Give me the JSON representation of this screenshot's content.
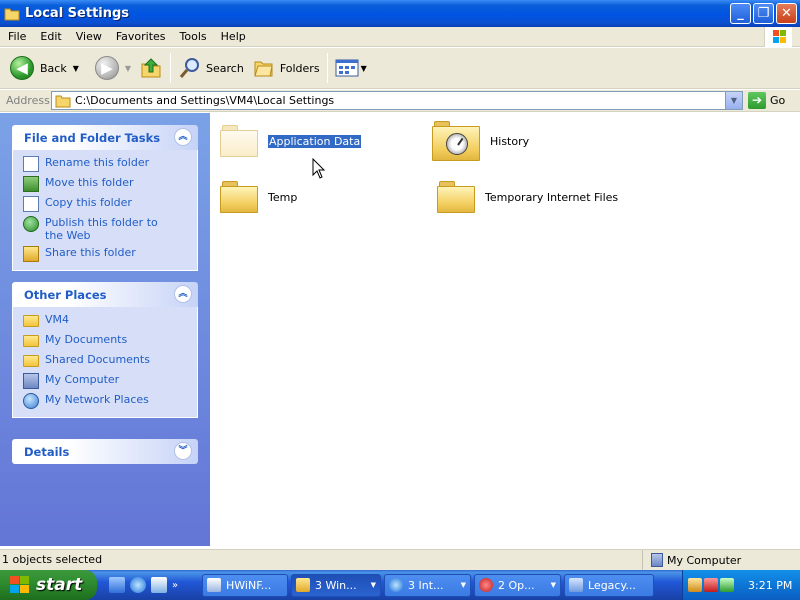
{
  "window": {
    "title": "Local Settings",
    "buttons": {
      "minimize": "_",
      "maximize": "❐",
      "close": "✕"
    }
  },
  "menu": {
    "items": [
      "File",
      "Edit",
      "View",
      "Favorites",
      "Tools",
      "Help"
    ]
  },
  "toolbar": {
    "back_label": "Back",
    "search_label": "Search",
    "folders_label": "Folders"
  },
  "address": {
    "label": "Address",
    "value": "C:\\Documents and Settings\\VM4\\Local Settings",
    "go_label": "Go"
  },
  "task_panes": {
    "file_tasks": {
      "title": "File and Folder Tasks",
      "items": [
        {
          "label": "Rename this folder",
          "icon": "rename-icon"
        },
        {
          "label": "Move this folder",
          "icon": "move-icon"
        },
        {
          "label": "Copy this folder",
          "icon": "copy-icon"
        },
        {
          "label": "Publish this folder to the Web",
          "icon": "publish-web-icon"
        },
        {
          "label": "Share this folder",
          "icon": "share-icon"
        }
      ]
    },
    "other_places": {
      "title": "Other Places",
      "items": [
        {
          "label": "VM4",
          "icon": "folder-icon"
        },
        {
          "label": "My Documents",
          "icon": "my-documents-icon"
        },
        {
          "label": "Shared Documents",
          "icon": "shared-documents-icon"
        },
        {
          "label": "My Computer",
          "icon": "my-computer-icon"
        },
        {
          "label": "My Network Places",
          "icon": "network-places-icon"
        }
      ]
    },
    "details": {
      "title": "Details"
    }
  },
  "files": [
    {
      "name": "Application Data",
      "selected": true,
      "icon": "folder-icon"
    },
    {
      "name": "History",
      "selected": false,
      "icon": "history-folder-icon"
    },
    {
      "name": "Temp",
      "selected": false,
      "icon": "folder-icon"
    },
    {
      "name": "Temporary Internet Files",
      "selected": false,
      "icon": "folder-icon"
    }
  ],
  "status": {
    "left": "1 objects selected",
    "right": "My Computer"
  },
  "taskbar": {
    "start_label": "start",
    "quick_launch_more": "»",
    "buttons": [
      {
        "label": "HWiNF..."
      },
      {
        "label": "3 Win..."
      },
      {
        "label": "3 Int..."
      },
      {
        "label": "2 Op..."
      },
      {
        "label": "Legacy..."
      }
    ],
    "clock": "3:21 PM"
  },
  "colors": {
    "titlebar": "#0054e3",
    "taskpane_link": "#215dc6",
    "selection": "#316ac5",
    "start_button": "#2f8c2f"
  }
}
